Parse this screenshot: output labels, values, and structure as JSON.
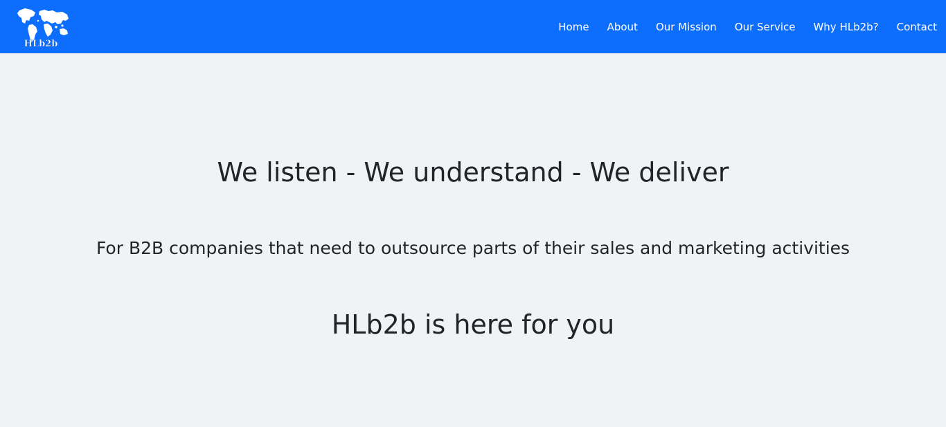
{
  "brand": {
    "logo_text": "HLb2b",
    "icon": "world-map-logo"
  },
  "nav": {
    "items": [
      {
        "label": "Home"
      },
      {
        "label": "About"
      },
      {
        "label": "Our Mission"
      },
      {
        "label": "Our Service"
      },
      {
        "label": "Why HLb2b?"
      },
      {
        "label": "Contact"
      }
    ]
  },
  "hero": {
    "headline": "We listen - We understand - We deliver",
    "subline": "For B2B companies that need to outsource parts of their sales and marketing activities",
    "tagline": "HLb2b is here for you"
  },
  "colors": {
    "navbar": "#0d6efd",
    "background": "#f0f2f5",
    "text": "#212529",
    "nav_text": "#ffffff"
  }
}
